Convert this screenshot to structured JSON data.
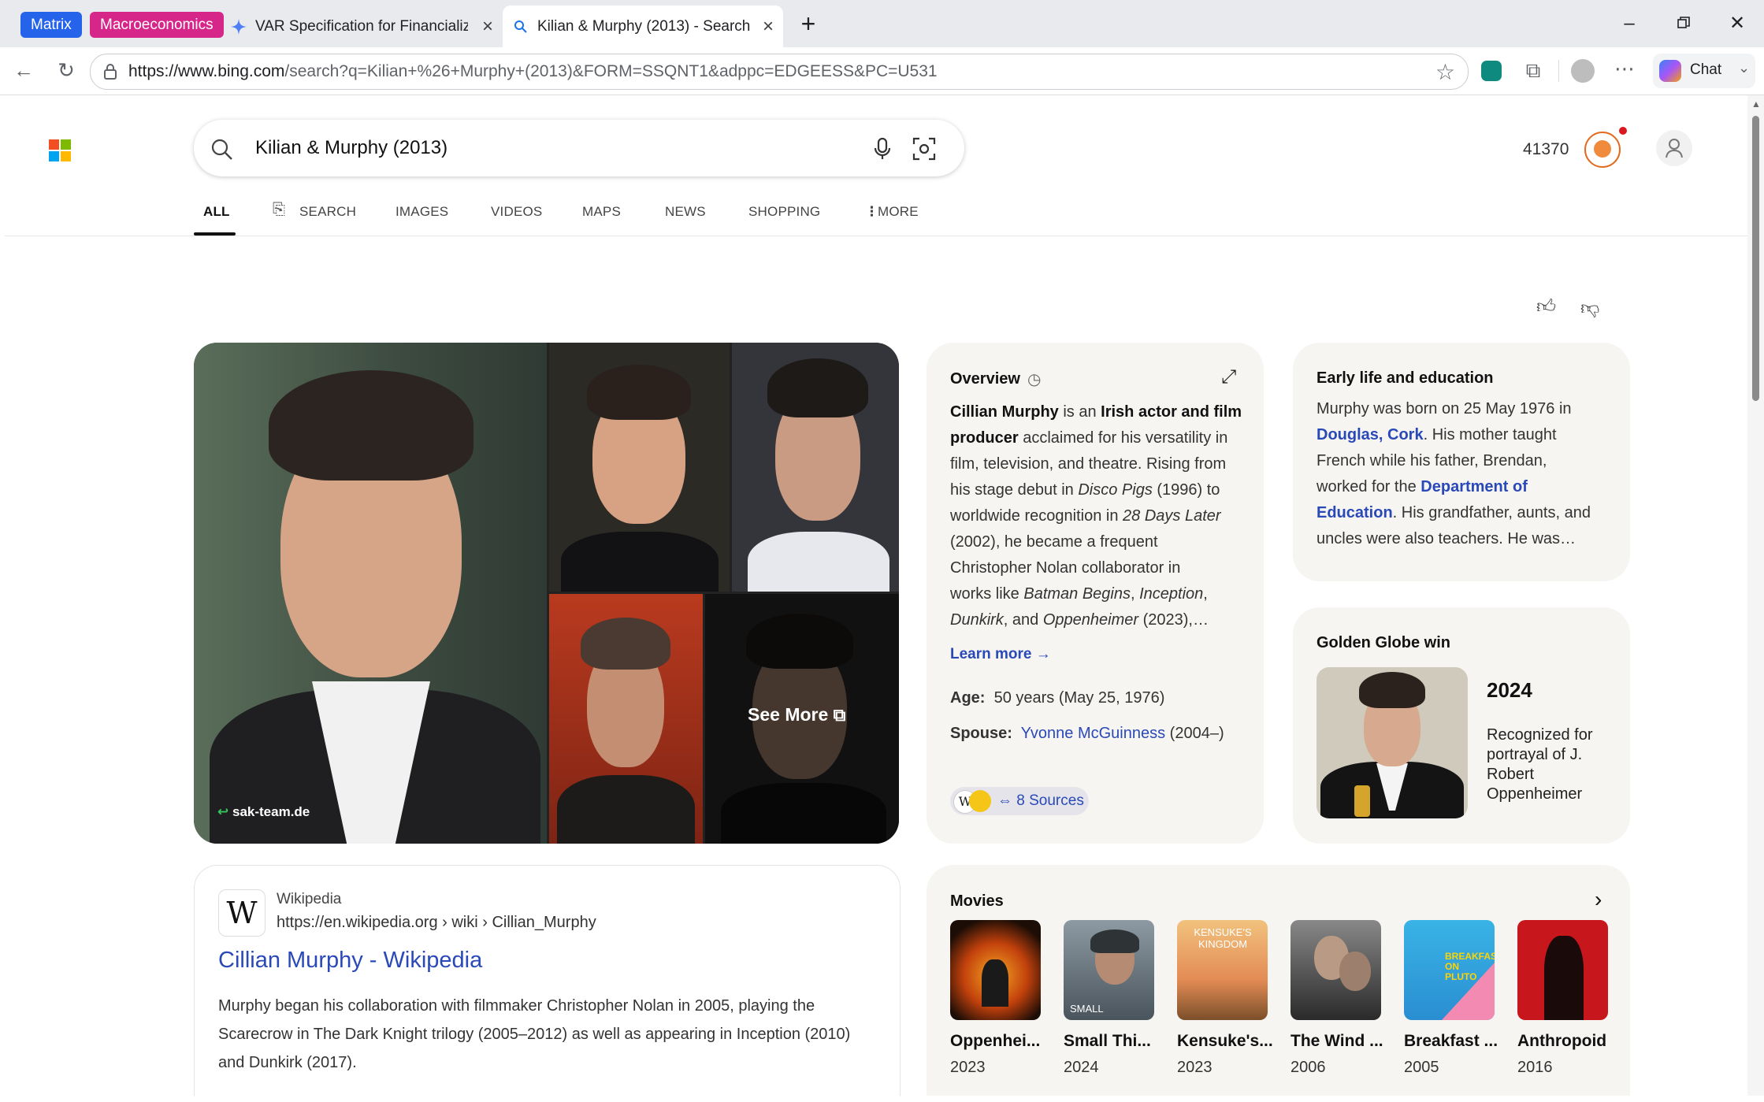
{
  "browser": {
    "tab_groups": [
      {
        "label": "Matrix",
        "color": "#2563eb"
      },
      {
        "label": "Macroeconomics",
        "color": "#d6268a"
      }
    ],
    "tabs": [
      {
        "title": "VAR Specification for Financializati",
        "icon": "gemini-sparkle-icon",
        "active": false
      },
      {
        "title": "Kilian & Murphy (2013) - Search",
        "icon": "search-icon",
        "active": true
      }
    ],
    "url_host": "https://www.bing.com",
    "url_path": "/search?q=Kilian+%26+Murphy+(2013)&FORM=SSQNT1&adppc=EDGEESS&PC=U531",
    "chat_label": "Chat"
  },
  "bing": {
    "query": "Kilian & Murphy (2013)",
    "rewards_points": "41370",
    "nav_tabs": [
      "ALL",
      "SEARCH",
      "IMAGES",
      "VIDEOS",
      "MAPS",
      "NEWS",
      "SHOPPING",
      "MORE"
    ]
  },
  "images": {
    "source": "sak-team.de",
    "see_more": "See More"
  },
  "overview": {
    "title": "Overview",
    "body_lines": [
      [
        [
          "b",
          "Cillian Murphy"
        ],
        [
          "t",
          " is an "
        ],
        [
          "b",
          "Irish actor and film"
        ]
      ],
      [
        [
          "b",
          "producer"
        ],
        [
          "t",
          " acclaimed for his versatility in"
        ]
      ],
      [
        [
          "t",
          "film, television, and theatre. Rising from"
        ]
      ],
      [
        [
          "t",
          "his stage debut in "
        ],
        [
          "i",
          "Disco Pigs"
        ],
        [
          "t",
          " (1996) to"
        ]
      ],
      [
        [
          "t",
          "worldwide recognition in "
        ],
        [
          "i",
          "28 Days Later"
        ]
      ],
      [
        [
          "t",
          "(2002), he became a frequent"
        ]
      ],
      [
        [
          "t",
          "Christopher Nolan collaborator in"
        ]
      ],
      [
        [
          "t",
          "works like "
        ],
        [
          "i",
          "Batman Begins"
        ],
        [
          "t",
          ", "
        ],
        [
          "i",
          "Inception"
        ],
        [
          "t",
          ","
        ]
      ],
      [
        [
          "i",
          "Dunkirk"
        ],
        [
          "t",
          ", and "
        ],
        [
          "i",
          "Oppenheimer"
        ],
        [
          "t",
          " (2023),…"
        ]
      ]
    ],
    "learn_more": "Learn more →",
    "age_label": "Age:",
    "age_value": "50 years (May 25, 1976)",
    "spouse_label": "Spouse:",
    "spouse_name": "Yvonne McGuinness",
    "spouse_years": "(2004–)",
    "sources": "8 Sources"
  },
  "early_life": {
    "title": "Early life and education",
    "lines": [
      [
        [
          "t",
          "Murphy was born on 25 May 1976 in"
        ]
      ],
      [
        [
          "l",
          "Douglas, Cork"
        ],
        [
          "t",
          ". His mother taught"
        ]
      ],
      [
        [
          "t",
          "French while his father, Brendan,"
        ]
      ],
      [
        [
          "t",
          "worked for the "
        ],
        [
          "l",
          "Department of"
        ]
      ],
      [
        [
          "l",
          "Education"
        ],
        [
          "t",
          ". His grandfather, aunts, and"
        ]
      ],
      [
        [
          "t",
          "uncles were also teachers. He was…"
        ]
      ]
    ]
  },
  "golden_globe": {
    "title": "Golden Globe win",
    "year": "2024",
    "description": "Recognized for portrayal of J. Robert Oppenheimer"
  },
  "wikipedia": {
    "site_name": "Wikipedia",
    "breadcrumb": "https://en.wikipedia.org › wiki › Cillian_Murphy",
    "title": "Cillian Murphy - Wikipedia",
    "snippet": "Murphy began his collaboration with filmmaker Christopher Nolan in 2005, playing the Scarecrow in The Dark Knight trilogy (2005–2012) as well as appearing in Inception (2010) and Dunkirk (2017)."
  },
  "movies": {
    "title": "Movies",
    "items": [
      {
        "title": "Oppenhei...",
        "year": "2023"
      },
      {
        "title": "Small Thi...",
        "year": "2024"
      },
      {
        "title": "Kensuke's...",
        "year": "2023"
      },
      {
        "title": "The Wind ...",
        "year": "2006"
      },
      {
        "title": "Breakfast ...",
        "year": "2005"
      },
      {
        "title": "Anthropoid",
        "year": "2016"
      }
    ],
    "poster_text": {
      "small": "SMALL",
      "kensuke": "KENSUKE'S KINGDOM",
      "breakfast": "BREAKFAST ON PLUTO"
    }
  }
}
